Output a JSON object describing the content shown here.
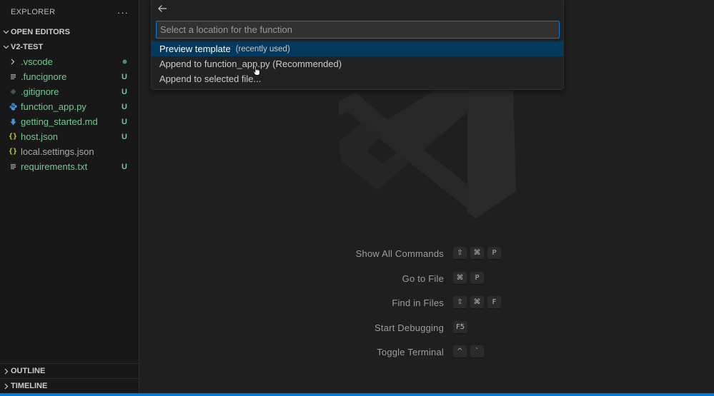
{
  "sidebar": {
    "title": "EXPLORER",
    "more": "···",
    "open_editors": "OPEN EDITORS",
    "folder": "V2-TEST",
    "files": [
      {
        "name": ".vscode",
        "badge": "",
        "icon": "chevron-right-icon"
      },
      {
        "name": ".funcignore",
        "badge": "U",
        "icon": "lines-icon"
      },
      {
        "name": ".gitignore",
        "badge": "U",
        "icon": "diamond-icon"
      },
      {
        "name": "function_app.py",
        "badge": "U",
        "icon": "python-icon"
      },
      {
        "name": "getting_started.md",
        "badge": "U",
        "icon": "markdown-icon"
      },
      {
        "name": "host.json",
        "badge": "U",
        "icon": "json-icon"
      },
      {
        "name": "local.settings.json",
        "badge": "",
        "icon": "json-icon"
      },
      {
        "name": "requirements.txt",
        "badge": "U",
        "icon": "lines-icon"
      }
    ],
    "outline": "OUTLINE",
    "timeline": "TIMELINE"
  },
  "quickpick": {
    "placeholder": "Select a location for the function",
    "items": [
      {
        "label": "Preview template",
        "description": "(recently used)"
      },
      {
        "label": "Append to function_app.py (Recommended)",
        "description": ""
      },
      {
        "label": "Append to selected file...",
        "description": ""
      }
    ]
  },
  "shortcuts": [
    {
      "label": "Show All Commands",
      "keys": [
        "⇧",
        "⌘",
        "P"
      ]
    },
    {
      "label": "Go to File",
      "keys": [
        "⌘",
        "P"
      ]
    },
    {
      "label": "Find in Files",
      "keys": [
        "⇧",
        "⌘",
        "F"
      ]
    },
    {
      "label": "Start Debugging",
      "keys": [
        "F5"
      ]
    },
    {
      "label": "Toggle Terminal",
      "keys": [
        "^",
        "`"
      ]
    }
  ],
  "colors": {
    "accent": "#0078d4",
    "untracked": "#73c991",
    "selection": "#04395e"
  }
}
